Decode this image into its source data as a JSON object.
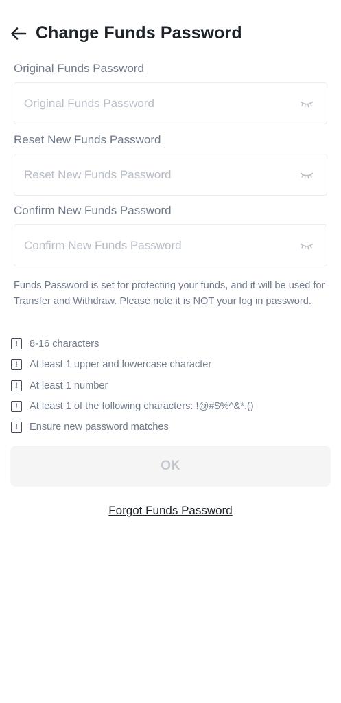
{
  "header": {
    "title": "Change Funds Password",
    "back_icon": "arrow-left-icon"
  },
  "fields": [
    {
      "label": "Original Funds Password",
      "placeholder": "Original Funds Password",
      "value": "",
      "toggle_icon": "eye-closed-icon"
    },
    {
      "label": "Reset New Funds Password",
      "placeholder": "Reset New Funds Password",
      "value": "",
      "toggle_icon": "eye-closed-icon"
    },
    {
      "label": "Confirm New Funds Password",
      "placeholder": "Confirm New Funds Password",
      "value": "",
      "toggle_icon": "eye-closed-icon"
    }
  ],
  "note": "Funds Password is set for protecting your funds, and it will be used for Transfer and Withdraw. Please note it is NOT your log in password.",
  "rules": [
    {
      "icon": "!",
      "text": "8-16 characters"
    },
    {
      "icon": "!",
      "text": "At least 1 upper and lowercase character"
    },
    {
      "icon": "!",
      "text": "At least 1 number"
    },
    {
      "icon": "!",
      "text": "At least 1 of the following characters: !@#$%^&*.()"
    },
    {
      "icon": "!",
      "text": "Ensure new password matches"
    }
  ],
  "ok_button": {
    "label": "OK",
    "enabled": false
  },
  "forgot_link": "Forgot Funds Password",
  "colors": {
    "title": "#1e2329",
    "label": "#707a8a",
    "placeholder": "#b7bdc6",
    "border": "#eaecef",
    "button_bg": "#f5f5f5",
    "button_text_disabled": "#c4c8ce"
  }
}
